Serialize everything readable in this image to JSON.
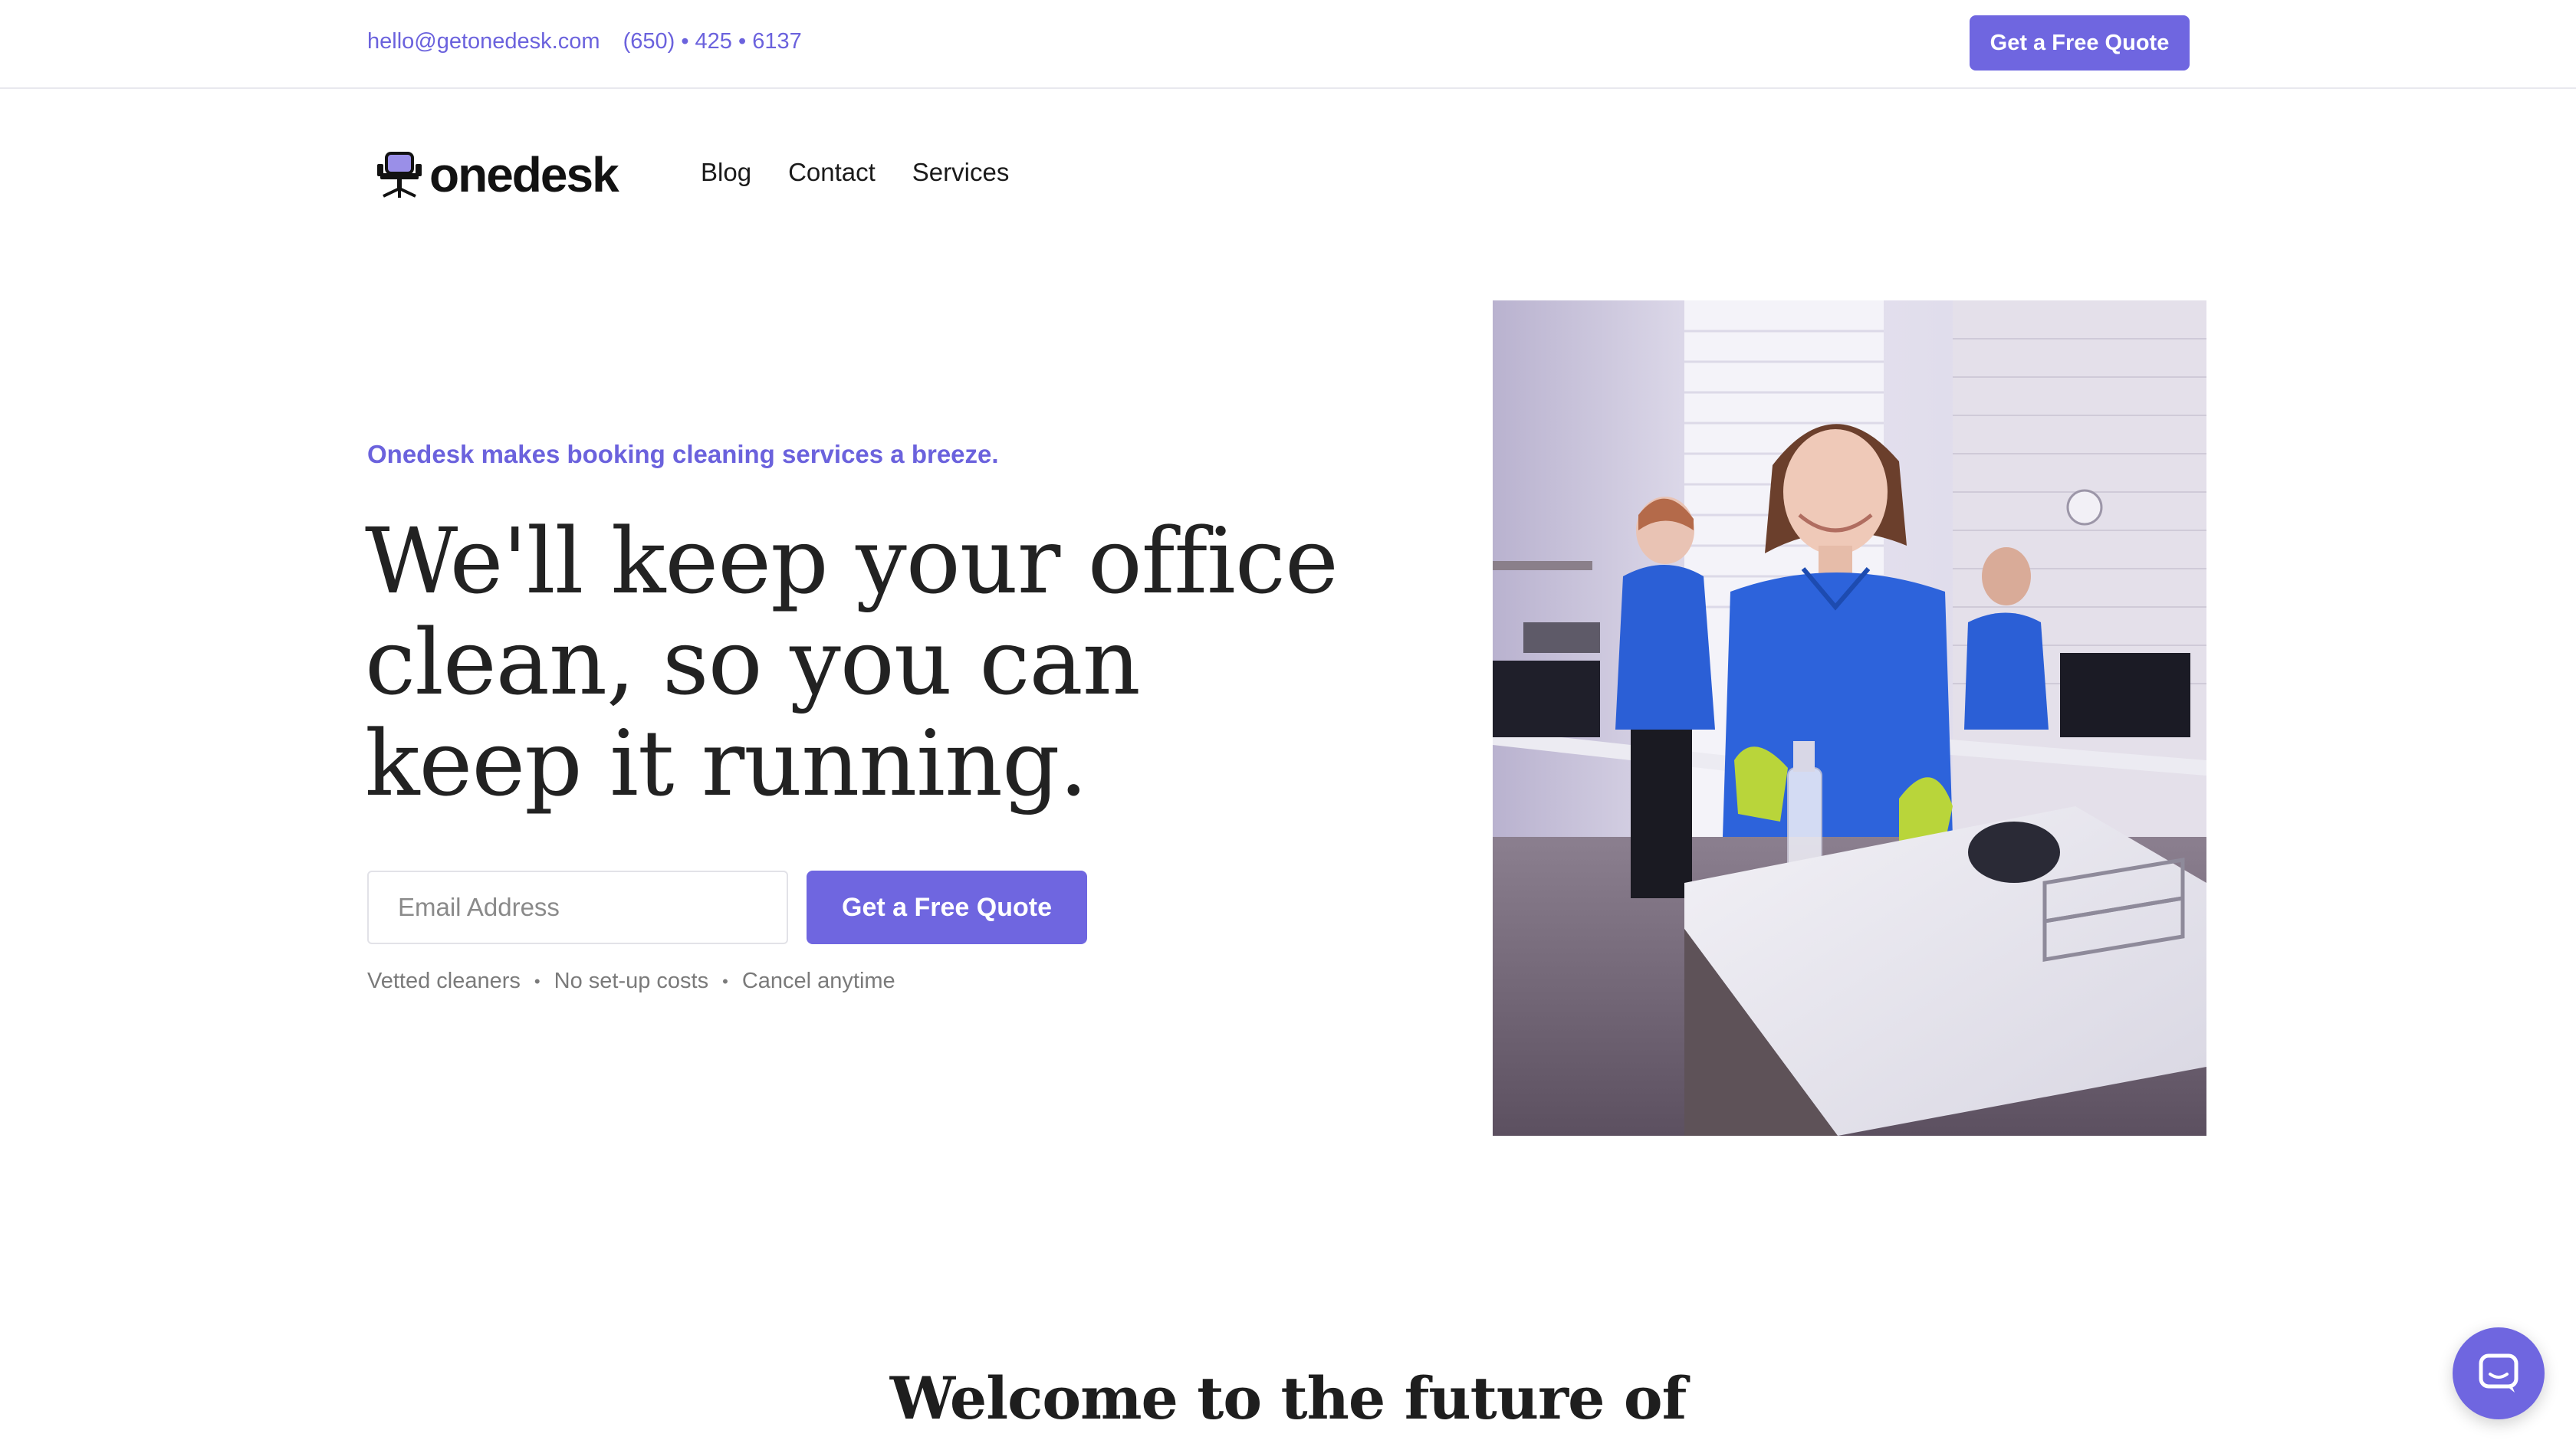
{
  "topbar": {
    "email": "hello@getonedesk.com",
    "phone": "(650) • 425 • 6137",
    "cta": "Get a Free Quote"
  },
  "nav": {
    "logo_text": "onedesk",
    "items": [
      {
        "label": "Blog"
      },
      {
        "label": "Contact"
      },
      {
        "label": "Services"
      }
    ]
  },
  "hero": {
    "eyebrow": "Onedesk makes booking cleaning services a breeze.",
    "headline_lines": [
      "We'll keep your office",
      "clean, so you can",
      "keep it running."
    ],
    "email_placeholder": "Email Address",
    "cta": "Get a Free Quote",
    "features": [
      "Vetted cleaners",
      "No set-up costs",
      "Cancel anytime"
    ],
    "feature_separator": "•"
  },
  "welcome": {
    "title_visible": "Welcome to the future of"
  },
  "colors": {
    "accent": "#6f66e0",
    "accent_text": "#6b62dd",
    "text": "#1f1f1f",
    "muted": "#7a7a7a"
  },
  "icons": {
    "logo": "office-chair-icon",
    "chat": "chat-bubble-icon"
  }
}
